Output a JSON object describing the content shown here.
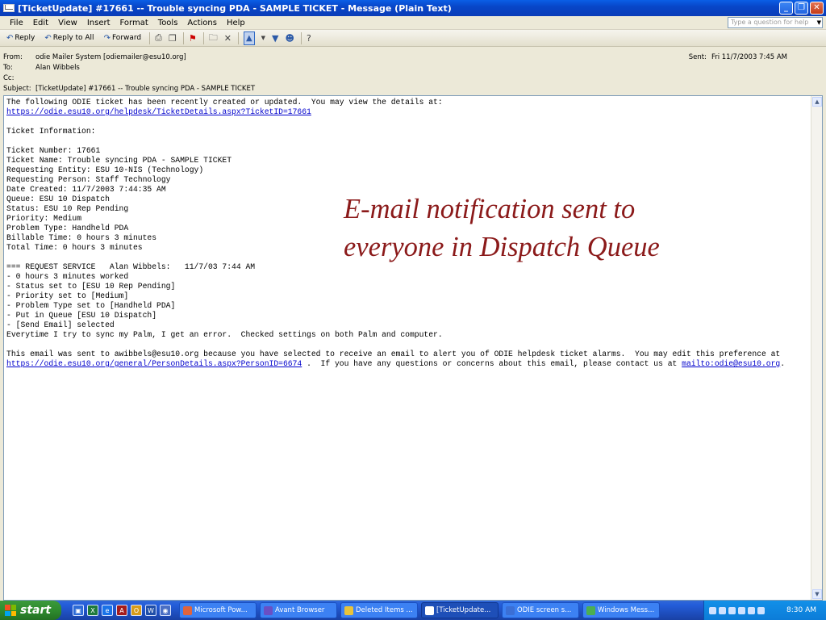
{
  "window": {
    "title": "[TicketUpdate] #17661 -- Trouble syncing PDA - SAMPLE TICKET - Message (Plain Text)",
    "minimize": "_",
    "restore": "❐",
    "close": "✕"
  },
  "menu": {
    "items": [
      "File",
      "Edit",
      "View",
      "Insert",
      "Format",
      "Tools",
      "Actions",
      "Help"
    ],
    "help_placeholder": "Type a question for help"
  },
  "toolbar": {
    "reply": "Reply",
    "reply_all": "Reply to All",
    "forward": "Forward"
  },
  "headers": {
    "from_label": "From:",
    "from_value": "odie Mailer System [odiemailer@esu10.org]",
    "to_label": "To:",
    "to_value": "Alan Wibbels",
    "cc_label": "Cc:",
    "cc_value": "",
    "subject_label": "Subject:",
    "subject_value": "[TicketUpdate] #17661 -- Trouble syncing PDA - SAMPLE TICKET",
    "sent_label": "Sent:",
    "sent_value": "Fri 11/7/2003 7:45 AM"
  },
  "message": {
    "intro": "The following ODIE ticket has been recently created or updated.  You may view the details at:",
    "ticket_link": "https://odie.esu10.org/helpdesk/TicketDetails.aspx?TicketID=17661",
    "ticket_info_heading": "Ticket Information:",
    "ticket_lines": [
      "Ticket Number: 17661",
      "Ticket Name: Trouble syncing PDA - SAMPLE TICKET",
      "Requesting Entity: ESU 10-NIS (Technology)",
      "Requesting Person: Staff Technology",
      "Date Created: 11/7/2003 7:44:35 AM",
      "Queue: ESU 10 Dispatch",
      "Status: ESU 10 Rep Pending",
      "Priority: Medium",
      "Problem Type: Handheld PDA",
      "Billable Time: 0 hours 3 minutes",
      "Total Time: 0 hours 3 minutes"
    ],
    "request_lines": [
      "=== REQUEST SERVICE   Alan Wibbels:   11/7/03 7:44 AM",
      "- 0 hours 3 minutes worked",
      "- Status set to [ESU 10 Rep Pending]",
      "- Priority set to [Medium]",
      "- Problem Type set to [Handheld PDA]",
      "- Put in Queue [ESU 10 Dispatch]",
      "- [Send Email] selected",
      "Everytime I try to sync my Palm, I get an error.  Checked settings on both Palm and computer."
    ],
    "footer_1": "This email was sent to awibbels@esu10.org because you have selected to receive an email to alert you of ODIE helpdesk ticket alarms.  You may edit this preference at ",
    "person_link": "https://odie.esu10.org/general/PersonDetails.aspx?PersonID=6674",
    "footer_2": " .  If you have any questions or concerns about this email, please contact us at ",
    "mail_link": "mailto:odie@esu10.org",
    "footer_3": "."
  },
  "annotation": {
    "line1": "E-mail notification sent to",
    "line2": "everyone in Dispatch Queue"
  },
  "taskbar": {
    "start": "start",
    "tasks": [
      "Microsoft Pow...",
      "Avant Browser",
      "Deleted Items ...",
      "[TicketUpdate...",
      "ODIE screen s...",
      "Windows Mess..."
    ],
    "clock": "8:30 AM"
  },
  "colors": {
    "annotation": "#8b1a1a",
    "link": "#0000cc",
    "titlebar": "#0a5ee6"
  }
}
